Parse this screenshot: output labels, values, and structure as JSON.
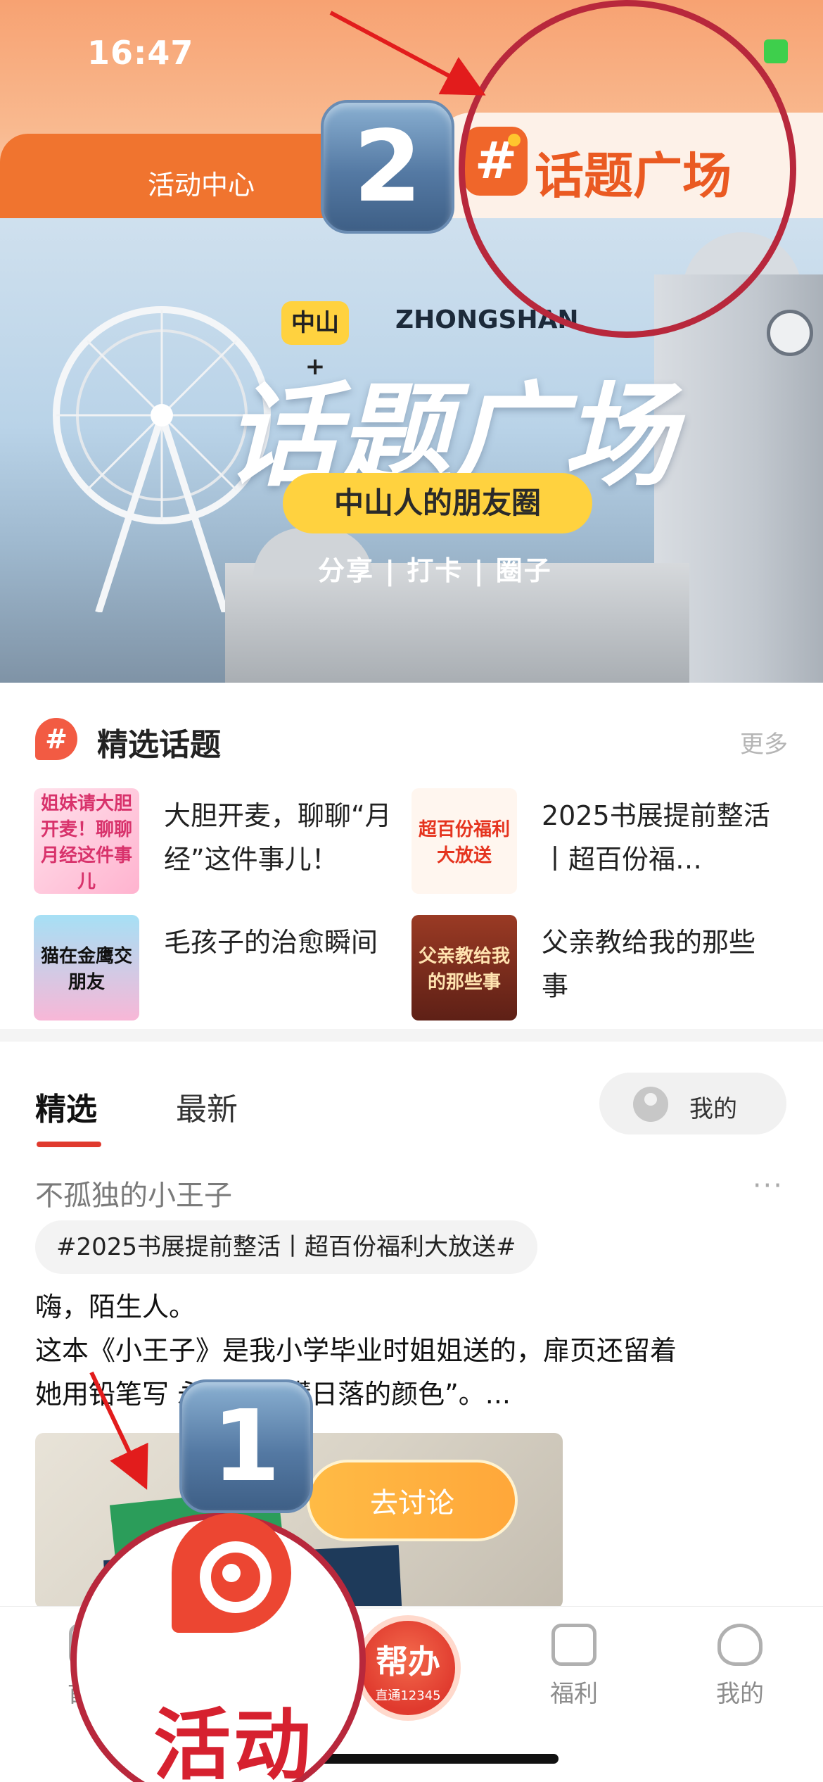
{
  "status_bar": {
    "time": "16:47"
  },
  "tabs": {
    "activity_center": "活动中心",
    "topic_square_hash": "#",
    "topic_square": "话题广场"
  },
  "annotations": {
    "badge_1": "1",
    "badge_2": "2",
    "activity_label": "活动"
  },
  "banner": {
    "brand": "中山+",
    "brand_en": "ZHONGSHAN",
    "title": "话题广场",
    "subtitle": "中山人的朋友圈",
    "tags": "分享 | 打卡 | 圈子"
  },
  "featured": {
    "icon": "#",
    "title": "精选话题",
    "more": "更多",
    "topics": [
      {
        "title": "大胆开麦，聊聊“月经”这件事儿！",
        "thumb": "姐妹请大胆开麦！聊聊月经这件事儿"
      },
      {
        "title": "2025书展提前整活丨超百份福…",
        "thumb": "超百份福利大放送"
      },
      {
        "title": "毛孩子的治愈瞬间",
        "thumb": "猫在金鹰交朋友"
      },
      {
        "title": "父亲教给我的那些事",
        "thumb": "父亲教给我的那些事"
      }
    ]
  },
  "feed": {
    "tab_selected": "精选",
    "tab_latest": "最新",
    "mine_button": "我的"
  },
  "post": {
    "author": "不孤独的小王子",
    "menu": "···",
    "tag": "#2025书展提前整活丨超百份福利大放送#",
    "body_line1": "嗨，陌生人。",
    "body_line2": "这本《小王子》是我小学毕业时姐姐送的，扉页还留着",
    "body_line3": "她用铅笔写   永远看得懂日落的颜色”。...",
    "discuss_button": "去讨论"
  },
  "bottom_nav": {
    "home": "首页",
    "center_big": "帮办",
    "center_small": "直通12345",
    "welfare": "福利",
    "mine": "我的"
  },
  "colors": {
    "accent": "#f0742f",
    "topic_orange": "#ea5a22",
    "annotation_red": "#b8283c",
    "discuss_button": "#ffb03f"
  }
}
